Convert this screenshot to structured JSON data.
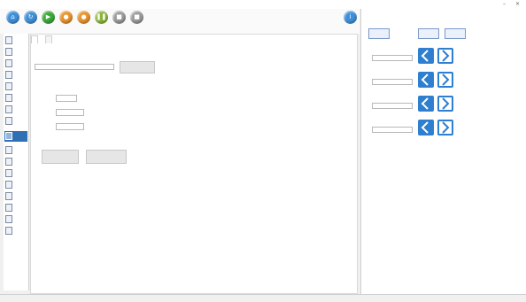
{
  "window": {
    "title": "",
    "min": "–",
    "close": "×"
  },
  "toolbar": {
    "tools": [
      {
        "icon": "home-icon",
        "color": "#3f8fd8"
      },
      {
        "icon": "refresh-icon",
        "color": "#3f8fd8"
      },
      {
        "icon": "play-icon",
        "color": "#3aa83a"
      },
      {
        "icon": "record-icon",
        "color": "#e8922a"
      },
      {
        "icon": "record-icon",
        "color": "#e8922a"
      },
      {
        "icon": "pause-icon",
        "color": "#8db63c"
      },
      {
        "icon": "stop-icon",
        "color": "#9a9a9a"
      },
      {
        "icon": "stop-icon",
        "color": "#9a9a9a"
      }
    ],
    "help_icon": "info-icon",
    "labels": [
      "",
      "",
      ""
    ]
  },
  "sidebar": {
    "items": [
      {
        "label": ""
      },
      {
        "label": ""
      },
      {
        "label": ""
      },
      {
        "label": ""
      },
      {
        "label": ""
      },
      {
        "label": ""
      },
      {
        "label": ""
      },
      {
        "label": ""
      },
      {
        "label": "",
        "active": true
      },
      {
        "label": ""
      },
      {
        "label": ""
      },
      {
        "label": ""
      },
      {
        "label": ""
      },
      {
        "label": ""
      },
      {
        "label": ""
      },
      {
        "label": ""
      },
      {
        "label": ""
      }
    ]
  },
  "left": {
    "tabs": [
      "",
      ""
    ],
    "path_section_title": "",
    "path_value": "",
    "browse_button": "",
    "params_section_title": "",
    "params": [
      {
        "label": "",
        "value": "",
        "unit": ""
      },
      {
        "label": "",
        "value": "",
        "unit": ""
      },
      {
        "label": "",
        "value": "",
        "unit": ""
      }
    ],
    "buttons": [
      "",
      ""
    ]
  },
  "right": {
    "tabs": [
      "",
      "",
      "",
      "",
      "",
      "",
      "",
      ""
    ],
    "buttons": [
      "",
      "",
      ""
    ],
    "axes": [
      {
        "name": "",
        "unit": "",
        "value": ""
      },
      {
        "name": "",
        "unit": "",
        "value": ""
      },
      {
        "name": "",
        "unit": "",
        "value": ""
      },
      {
        "name": "",
        "unit": "",
        "value": ""
      }
    ]
  },
  "status": {
    "left": "",
    "right": ""
  },
  "colors": {
    "accent": "#2e7fd0",
    "section_green": "#1a8a1a",
    "sidebar_active": "#2f6fb4"
  }
}
